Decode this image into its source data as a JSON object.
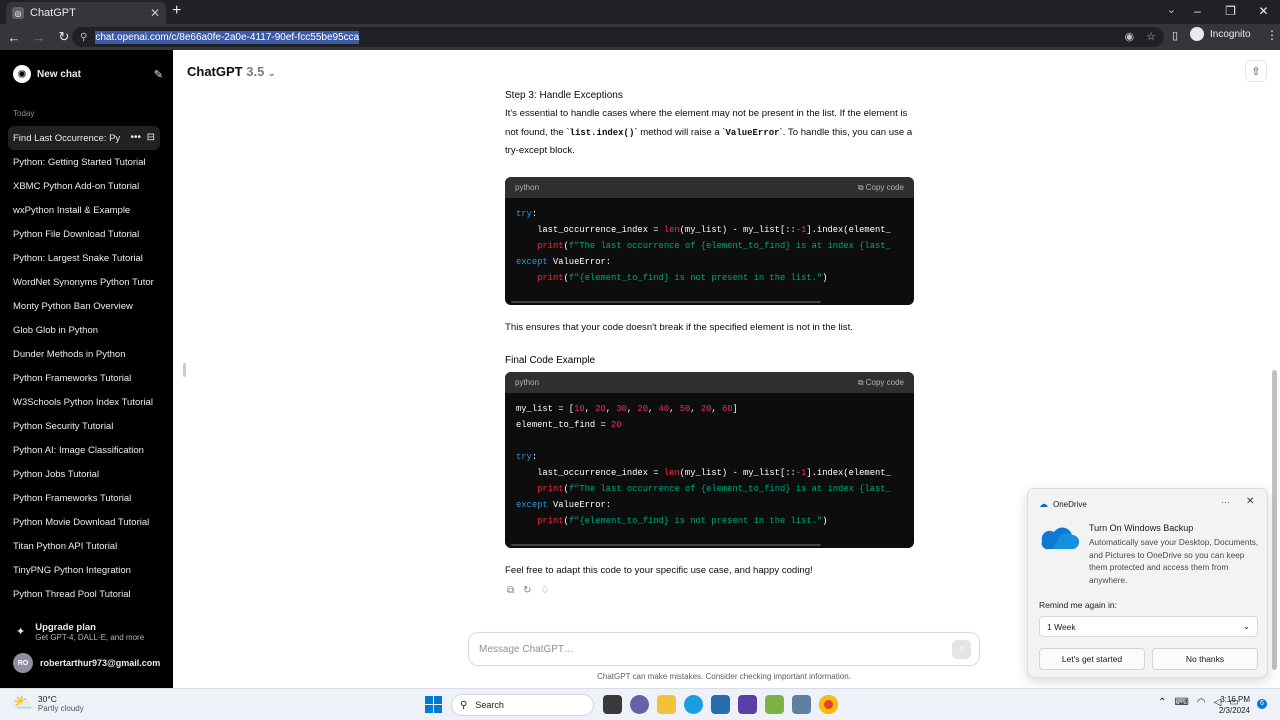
{
  "browser": {
    "tab_title": "ChatGPT",
    "url": "chat.openai.com/c/8e66a0fe-2a0e-4117-90ef-fcc55be95cca",
    "profile_label": "Incognito"
  },
  "sidebar": {
    "new_chat": "New chat",
    "section": "Today",
    "items": [
      "Find Last Occurrence: Py",
      "Python: Getting Started Tutorial",
      "XBMC Python Add-on Tutorial",
      "wxPython Install & Example",
      "Python File Download Tutorial",
      "Python: Largest Snake Tutorial",
      "WordNet Synonyms Python Tutor",
      "Monty Python Ban Overview",
      "Glob Glob in Python",
      "Dunder Methods in Python",
      "Python Frameworks Tutorial",
      "W3Schools Python Index Tutorial",
      "Python Security Tutorial",
      "Python AI: Image Classification",
      "Python Jobs Tutorial",
      "Python Frameworks Tutorial",
      "Python Movie Download Tutorial",
      "Titan Python API Tutorial",
      "TinyPNG Python Integration",
      "Python Thread Pool Tutorial"
    ],
    "upgrade_title": "Upgrade plan",
    "upgrade_sub": "Get GPT-4, DALL·E, and more",
    "user_initials": "RO",
    "user_email": "robertarthur973@gmail.com"
  },
  "header": {
    "model": "ChatGPT",
    "version": "3.5"
  },
  "content": {
    "step3_heading": "Step 3: Handle Exceptions",
    "step3_p1": "It's essential to handle cases where the element may not be present in the list. If the element is not found, the `",
    "step3_code1": "list.index()",
    "step3_p2": "` method will raise a `",
    "step3_code2": "ValueError",
    "step3_p3": "`. To handle this, you can use a try-except block.",
    "code1_lang": "python",
    "copy_label": "Copy code",
    "ensures": "This ensures that your code doesn't break if the specified element is not in the list.",
    "final_heading": "Final Code Example",
    "code2_lang": "python",
    "closing": "Feel free to adapt this code to your specific use case, and happy coding!"
  },
  "composer": {
    "placeholder": "Message ChatGPT…",
    "disclaimer": "ChatGPT can make mistakes. Consider checking important information."
  },
  "toast": {
    "app": "OneDrive",
    "title": "Turn On Windows Backup",
    "body": "Automatically save your Desktop, Documents, and Pictures to OneDrive so you can keep them protected and access them from anywhere.",
    "remind_label": "Remind me again in:",
    "remind_value": "1 Week",
    "primary": "Let's get started",
    "secondary": "No thanks"
  },
  "taskbar": {
    "temp": "30°C",
    "weather": "Partly cloudy",
    "search": "Search",
    "time": "3:16 PM",
    "date": "2/3/2024",
    "notifications": "6"
  }
}
